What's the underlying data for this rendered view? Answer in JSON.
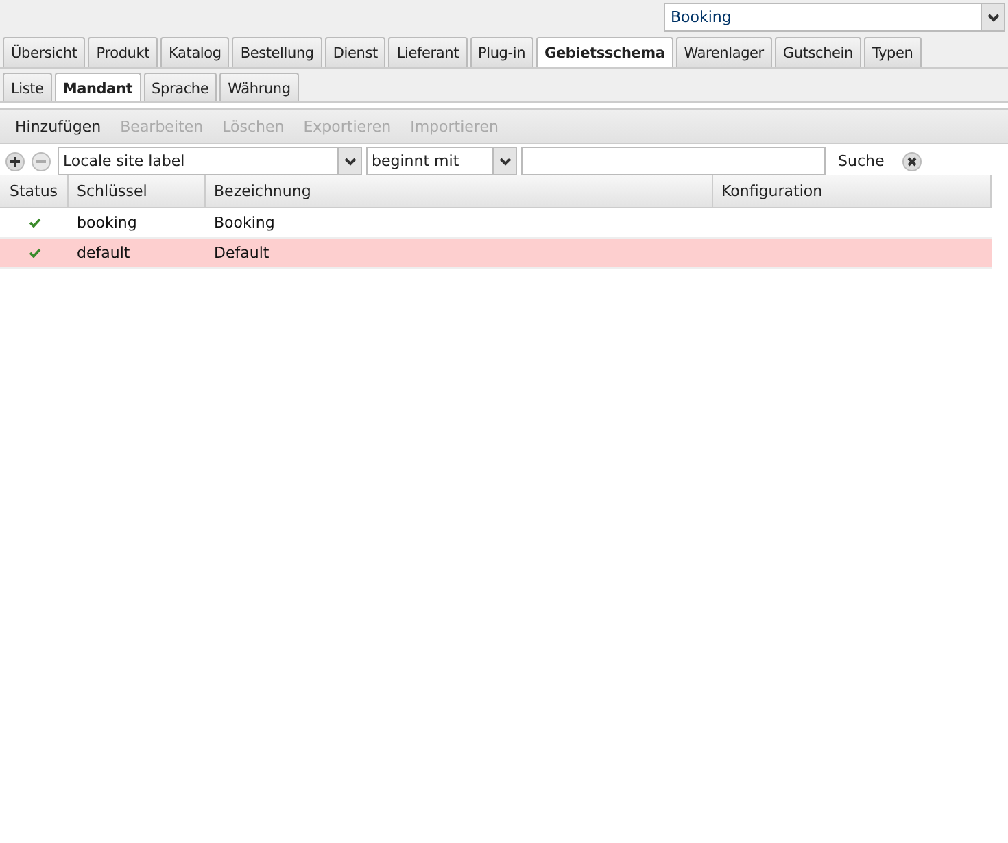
{
  "site_select": {
    "value": "Booking"
  },
  "tabs": [
    {
      "label": "Übersicht",
      "selected": false
    },
    {
      "label": "Produkt",
      "selected": false
    },
    {
      "label": "Katalog",
      "selected": false
    },
    {
      "label": "Bestellung",
      "selected": false
    },
    {
      "label": "Dienst",
      "selected": false
    },
    {
      "label": "Lieferant",
      "selected": false
    },
    {
      "label": "Plug-in",
      "selected": false
    },
    {
      "label": "Gebietsschema",
      "selected": true
    },
    {
      "label": "Warenlager",
      "selected": false
    },
    {
      "label": "Gutschein",
      "selected": false
    },
    {
      "label": "Typen",
      "selected": false
    }
  ],
  "subtabs": [
    {
      "label": "Liste",
      "selected": false
    },
    {
      "label": "Mandant",
      "selected": true
    },
    {
      "label": "Sprache",
      "selected": false
    },
    {
      "label": "Währung",
      "selected": false
    }
  ],
  "toolbar": [
    {
      "label": "Hinzufügen",
      "disabled": false
    },
    {
      "label": "Bearbeiten",
      "disabled": true
    },
    {
      "label": "Löschen",
      "disabled": true
    },
    {
      "label": "Exportieren",
      "disabled": true
    },
    {
      "label": "Importieren",
      "disabled": true
    }
  ],
  "filter": {
    "field": "Locale site label",
    "operator": "beginnt mit",
    "search_label": "Suche"
  },
  "table": {
    "columns": [
      "Status",
      "Schlüssel",
      "Bezeichnung",
      "Konfiguration"
    ],
    "rows": [
      {
        "status_ok": true,
        "key": "booking",
        "label": "Booking",
        "selected": false
      },
      {
        "status_ok": true,
        "key": "default",
        "label": "Default",
        "selected": true
      }
    ]
  }
}
